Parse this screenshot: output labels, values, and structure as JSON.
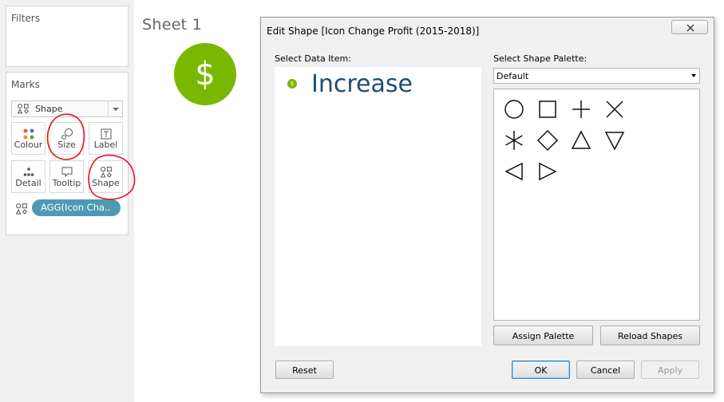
{
  "left_pane": {
    "filters_title": "Filters",
    "marks_title": "Marks",
    "mark_type": "Shape",
    "mark_buttons": [
      {
        "label": "Colour",
        "icon": "colour-dots-icon"
      },
      {
        "label": "Size",
        "icon": "size-bubble-icon"
      },
      {
        "label": "Label",
        "icon": "label-text-icon"
      },
      {
        "label": "Detail",
        "icon": "detail-dots-icon"
      },
      {
        "label": "Tooltip",
        "icon": "tooltip-bubble-icon"
      },
      {
        "label": "Shape",
        "icon": "shapes-icon"
      }
    ],
    "field_pill": "AGG(Icon Cha.."
  },
  "sheet": {
    "title": "Sheet 1",
    "mark_symbol": "$",
    "mark_color": "#7ab800"
  },
  "dialog": {
    "title": "Edit Shape [Icon Change Profit (2015-2018)]",
    "select_data_item_label": "Select Data Item:",
    "data_items": [
      {
        "label": "Increase",
        "color": "#7ab800",
        "symbol": "$"
      }
    ],
    "select_palette_label": "Select Shape Palette:",
    "palette_value": "Default",
    "shapes": [
      "circle",
      "square",
      "plus",
      "cross",
      "asterisk",
      "diamond",
      "triangle-up",
      "triangle-down",
      "triangle-left",
      "triangle-right"
    ],
    "buttons": {
      "assign_palette": "Assign Palette",
      "reload_shapes": "Reload Shapes",
      "reset": "Reset",
      "ok": "OK",
      "cancel": "Cancel",
      "apply": "Apply"
    }
  },
  "annotation_color": "#e8141c"
}
